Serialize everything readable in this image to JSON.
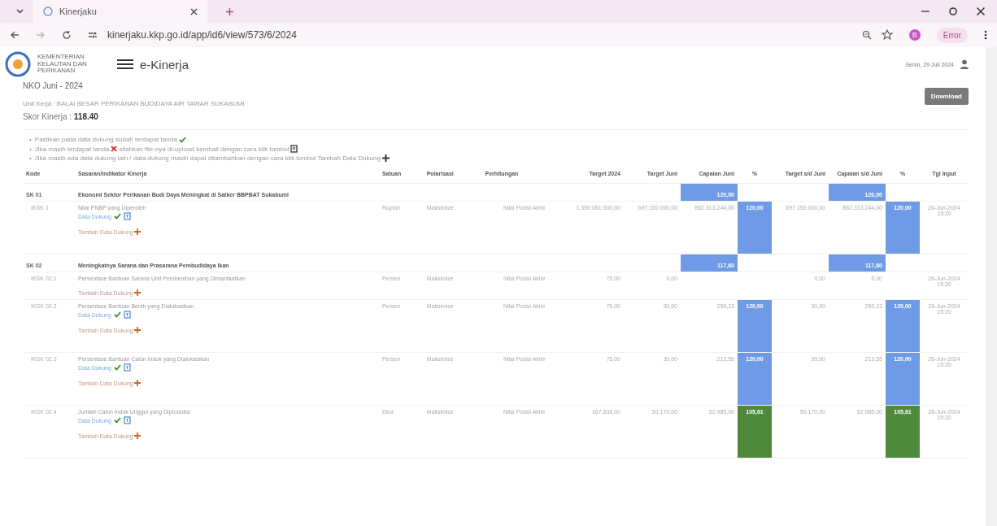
{
  "browser": {
    "tab_title": "Kinerjaku",
    "url": "kinerjaku.kkp.go.id/app/id6/view/573/6/2024",
    "profile_initial": "B",
    "profile_status": "Error"
  },
  "header": {
    "ministry": "KEMENTERIAN KELAUTAN DAN PERIKANAN",
    "app_name": "e-Kinerja",
    "date": "Senin, 29 Juli 2024"
  },
  "report": {
    "title": "NKO Juni - 2024",
    "unit": "Unit Kerja : BALAI BESAR PERIKANAN BUDIDAYA AIR TAWAR SUKABUMI",
    "score_label": "Skor Kinerja :",
    "score": "118.40",
    "download": "Download"
  },
  "notes": [
    {
      "bullet": "•",
      "text": "Pastikan pada data dukung sudah terdapat tanda",
      "kind": "verified"
    },
    {
      "bullet": "•",
      "text": "Jika masih terdapat tanda",
      "kind": "reupload",
      "text_after": "silahkan file-nya di-upload kembali dengan cara klik tombol"
    },
    {
      "bullet": "•",
      "text": "Jika masih ada data dukung lain / data dukung masih dapat ditambahkan dengan cara klik tombol Tambah Data Dukung",
      "kind": "add"
    }
  ],
  "table": {
    "columns": [
      "Kode",
      "Sasaran/Indikator Kinerja",
      "Satuan",
      "Polarisasi",
      "Perhitungan",
      "Target 2024",
      "Target Juni",
      "Capaian Juni",
      "%",
      "Target s/d Juni",
      "Capaian s/d Juni",
      "%",
      "Tgl Input"
    ],
    "groups": [
      {
        "code": "SK 01",
        "title": "Ekonomi Sektor Perikanan Budi Daya Meningkat di Satker BBPBAT Sukabumi",
        "score": "120,00",
        "score_sd": "120,00",
        "color": "#6f9be6",
        "rows": [
          {
            "code": "IKSK 1",
            "name": "Nilai PNBP yang Diperoleh",
            "data_dukung": {
              "label": "Data Dukung",
              "verified": true
            },
            "add_label": "Tambah Data Dukung",
            "satuan": "Rupiah",
            "polarisasi": "Maksimize",
            "perhitungan": "Nilai Posisi Akhir",
            "target_2024": "1.350.081.000,00",
            "target_juni": "697.150.000,00",
            "capaian_juni": "862.313.244,00",
            "pct": "120,00",
            "color": "#6f9be6",
            "target_sd": "697.150.000,00",
            "capaian_sd": "862.313.244,00",
            "pct_sd": "120,00",
            "tgl": "26-Jun-2024 15:20"
          }
        ]
      },
      {
        "code": "SK 02",
        "title": "Meningkatnya Sarana dan Prasarana Pembudidaya Ikan",
        "score": "117,60",
        "score_sd": "117,60",
        "color": "#6f9be6",
        "rows": [
          {
            "code": "IKSK 02.1",
            "name": "Persentase Bantuan Sarana Unit Pembenihan yang Dimanfaatkan",
            "add_label": "Tambah Data Dukung",
            "satuan": "Persen",
            "polarisasi": "Maksimize",
            "perhitungan": "Nilai Posisi Akhir",
            "target_2024": "75,00",
            "target_juni": "0,00",
            "target_sd": "0,00",
            "capaian_sd": "0,00",
            "tgl": "26-Jun-2024 15:20"
          },
          {
            "code": "IKSK 02.2",
            "name": "Persentase Bantuan Benih yang Dialokasikan",
            "data_dukung": {
              "label": "Data Dukung",
              "verified": true
            },
            "add_label": "Tambah Data Dukung",
            "satuan": "Persen",
            "polarisasi": "Maksimize",
            "perhitungan": "Nilai Posisi Akhir",
            "target_2024": "75,00",
            "target_juni": "30,00",
            "capaian_juni": "259,13",
            "pct": "120,00",
            "color": "#6f9be6",
            "target_sd": "30,00",
            "capaian_sd": "259,13",
            "pct_sd": "120,00",
            "tgl": "26-Jun-2024 15:20"
          },
          {
            "code": "IKSK 02.3",
            "name": "Persentase Bantuan Calon Induk yang Dialokasikan",
            "data_dukung": {
              "label": "Data Dukung",
              "verified": true
            },
            "add_label": "Tambah Data Dukung",
            "satuan": "Persen",
            "polarisasi": "Maksimize",
            "perhitungan": "Nilai Posisi Akhir",
            "target_2024": "75,00",
            "target_juni": "30,00",
            "capaian_juni": "213,55",
            "pct": "120,00",
            "color": "#6f9be6",
            "target_sd": "30,00",
            "capaian_sd": "213,55",
            "pct_sd": "120,00",
            "tgl": "26-Jun-2024 15:20"
          },
          {
            "code": "IKSK 02.4",
            "name": "Jumlah Calon Induk Unggul yang Diproduksi",
            "data_dukung": {
              "label": "Data Dukung",
              "verified": true
            },
            "add_label": "Tambah Data Dukung",
            "satuan": "Ekor",
            "polarisasi": "Maksimize",
            "perhitungan": "Nilai Posisi Akhir",
            "target_2024": "167.638,00",
            "target_juni": "50.170,00",
            "capaian_juni": "52.985,00",
            "pct": "105,61",
            "color": "#4f8a3c",
            "target_sd": "50.170,00",
            "capaian_sd": "52.985,00",
            "pct_sd": "105,61",
            "tgl": "26-Jun-2024 15:20"
          }
        ]
      }
    ]
  }
}
